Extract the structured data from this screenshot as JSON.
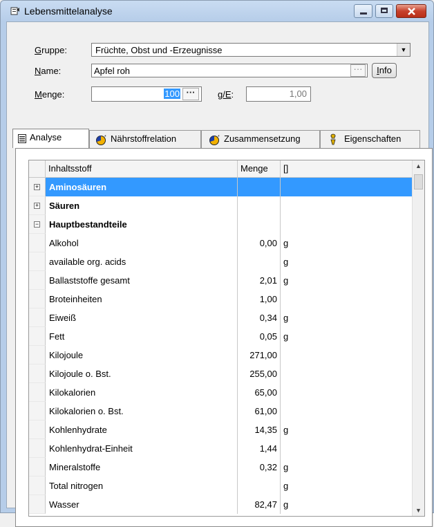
{
  "window": {
    "title": "Lebensmittelanalyse"
  },
  "form": {
    "gruppe_label_u": "G",
    "gruppe_label_rest": "ruppe:",
    "gruppe_value": "Früchte, Obst und -Erzeugnisse",
    "name_label_u": "N",
    "name_label_rest": "ame:",
    "name_value": "Apfel roh",
    "info_label_u": "I",
    "info_label_rest": "nfo",
    "menge_label_u": "M",
    "menge_label_rest": "enge:",
    "menge_value": "100",
    "ge_label_u": "g/E",
    "ge_label_rest": ":",
    "ge_value": "1,00",
    "ellipsis": "···"
  },
  "tabs": [
    {
      "label": "Analyse",
      "icon": "document-icon"
    },
    {
      "label": "Nährstoffrelation",
      "icon": "pie-chart-icon"
    },
    {
      "label": "Zusammensetzung",
      "icon": "pie-chart-icon"
    },
    {
      "label": "Eigenschaften",
      "icon": "properties-icon"
    }
  ],
  "grid": {
    "headers": [
      "Inhaltsstoff",
      "Menge",
      "[]"
    ],
    "rows": [
      {
        "name": "Aminosäuren",
        "menge": "",
        "unit": "",
        "group": true,
        "expander": "+",
        "selected": true
      },
      {
        "name": "Säuren",
        "menge": "",
        "unit": "",
        "group": true,
        "expander": "+"
      },
      {
        "name": "Hauptbestandteile",
        "menge": "",
        "unit": "",
        "group": true,
        "expander": "−"
      },
      {
        "name": "Alkohol",
        "menge": "0,00",
        "unit": "g"
      },
      {
        "name": "available org. acids",
        "menge": "",
        "unit": "g"
      },
      {
        "name": "Ballaststoffe gesamt",
        "menge": "2,01",
        "unit": "g"
      },
      {
        "name": "Broteinheiten",
        "menge": "1,00",
        "unit": ""
      },
      {
        "name": "Eiweiß",
        "menge": "0,34",
        "unit": "g"
      },
      {
        "name": "Fett",
        "menge": "0,05",
        "unit": "g"
      },
      {
        "name": "Kilojoule",
        "menge": "271,00",
        "unit": ""
      },
      {
        "name": "Kilojoule o. Bst.",
        "menge": "255,00",
        "unit": ""
      },
      {
        "name": "Kilokalorien",
        "menge": "65,00",
        "unit": ""
      },
      {
        "name": "Kilokalorien o. Bst.",
        "menge": "61,00",
        "unit": ""
      },
      {
        "name": "Kohlenhydrate",
        "menge": "14,35",
        "unit": "g"
      },
      {
        "name": "Kohlenhydrat-Einheit",
        "menge": "1,44",
        "unit": ""
      },
      {
        "name": "Mineralstoffe",
        "menge": "0,32",
        "unit": "g"
      },
      {
        "name": "Total nitrogen",
        "menge": "",
        "unit": "g"
      },
      {
        "name": "Wasser",
        "menge": "82,47",
        "unit": "g"
      }
    ]
  }
}
